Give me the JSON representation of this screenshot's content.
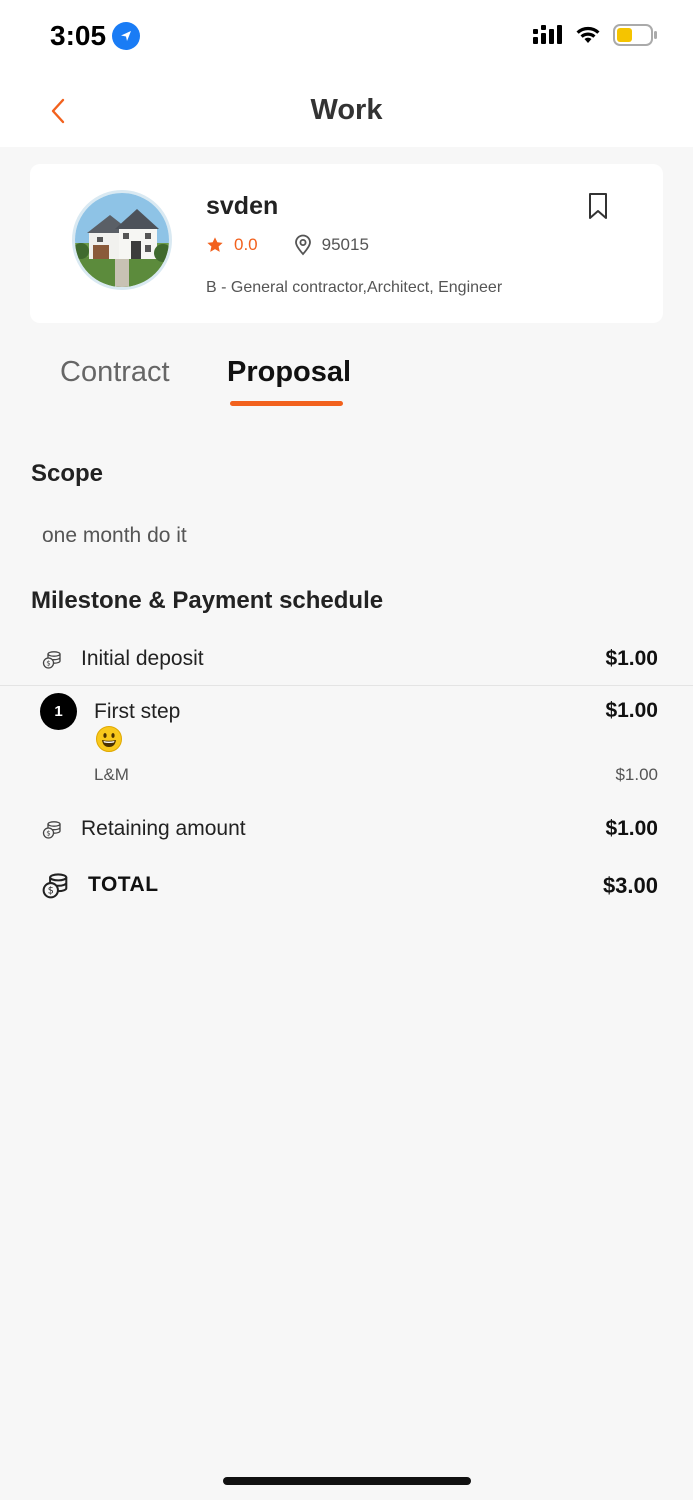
{
  "status_bar": {
    "time": "3:05"
  },
  "header": {
    "title": "Work"
  },
  "profile": {
    "name": "svden",
    "rating": "0.0",
    "zip": "95015",
    "license": "B - General contractor,Architect, Engineer"
  },
  "tabs": [
    {
      "label": "Contract",
      "active": false
    },
    {
      "label": "Proposal",
      "active": true
    }
  ],
  "scope": {
    "title": "Scope",
    "text": "one month do it"
  },
  "schedule": {
    "title": "Milestone & Payment schedule",
    "initial_deposit": {
      "label": "Initial deposit",
      "amount": "$1.00"
    },
    "milestones": [
      {
        "number": "1",
        "label": "First step",
        "amount": "$1.00",
        "sub_label": "L&M",
        "sub_amount": "$1.00"
      }
    ],
    "retaining": {
      "label": "Retaining amount",
      "amount": "$1.00"
    },
    "total": {
      "label": "TOTAL",
      "amount": "$3.00"
    }
  },
  "colors": {
    "accent": "#f2611d",
    "background": "#f7f7f7",
    "card": "#ffffff",
    "location_blue": "#1a7cf5",
    "battery_yellow": "#f5c400"
  },
  "icons": {
    "back": "chevron-left-icon",
    "bookmark": "bookmark-icon",
    "star": "star-icon",
    "location": "location-pin-icon",
    "coins": "coins-icon"
  }
}
